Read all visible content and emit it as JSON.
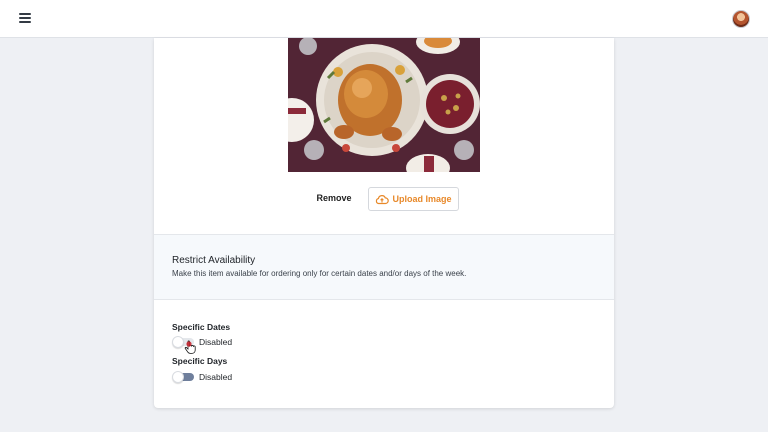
{
  "topbar": {
    "menu_icon": "hamburger-menu-icon",
    "avatar_icon": "user-avatar"
  },
  "image_section": {
    "image_subject": "roast-turkey-dinner-photo",
    "remove_label": "Remove",
    "upload_label": "Upload Image",
    "upload_icon": "cloud-upload-icon",
    "accent_color": "#e8892a"
  },
  "availability": {
    "title": "Restrict Availability",
    "description": "Make this item available for ordering only for certain dates and/or days of the week."
  },
  "specific_dates": {
    "label": "Specific Dates",
    "state": "Disabled",
    "enabled": false
  },
  "specific_days": {
    "label": "Specific Days",
    "state": "Disabled",
    "enabled": false
  },
  "colors": {
    "page_background": "#eef0f4",
    "toggle_track": "#6f7f9c"
  }
}
